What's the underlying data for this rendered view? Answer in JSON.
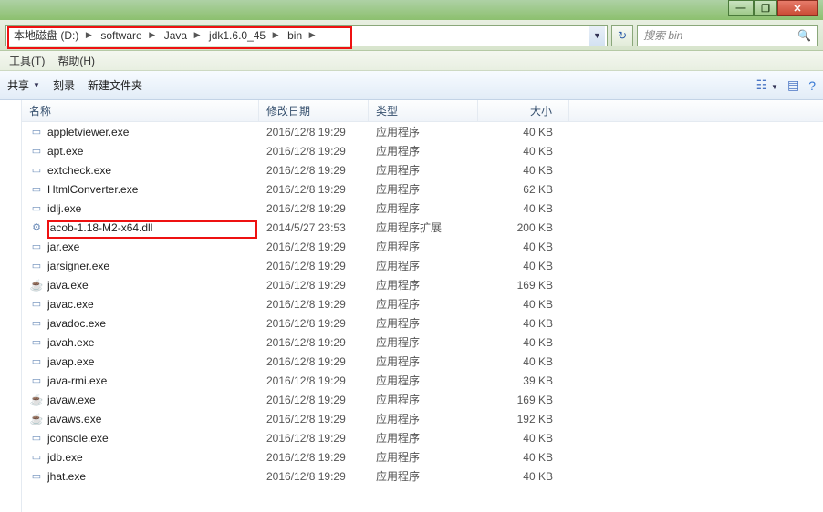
{
  "window": {
    "minimize": "—",
    "maximize": "❐",
    "close": "✕"
  },
  "breadcrumb": {
    "items": [
      "本地磁盘 (D:)",
      "software",
      "Java",
      "jdk1.6.0_45",
      "bin"
    ]
  },
  "search": {
    "placeholder": "搜索 bin"
  },
  "menu": {
    "tools": "工具(T)",
    "help": "帮助(H)"
  },
  "toolbar": {
    "share": "共享",
    "burn": "刻录",
    "newfolder": "新建文件夹"
  },
  "columns": {
    "name": "名称",
    "date": "修改日期",
    "type": "类型",
    "size": "大小"
  },
  "types": {
    "app": "应用程序",
    "ext": "应用程序扩展"
  },
  "files": [
    {
      "name": "appletviewer.exe",
      "date": "2016/12/8 19:29",
      "typeKey": "app",
      "size": "40 KB",
      "icon": "exe"
    },
    {
      "name": "apt.exe",
      "date": "2016/12/8 19:29",
      "typeKey": "app",
      "size": "40 KB",
      "icon": "exe"
    },
    {
      "name": "extcheck.exe",
      "date": "2016/12/8 19:29",
      "typeKey": "app",
      "size": "40 KB",
      "icon": "exe"
    },
    {
      "name": "HtmlConverter.exe",
      "date": "2016/12/8 19:29",
      "typeKey": "app",
      "size": "62 KB",
      "icon": "exe"
    },
    {
      "name": "idlj.exe",
      "date": "2016/12/8 19:29",
      "typeKey": "app",
      "size": "40 KB",
      "icon": "exe"
    },
    {
      "name": "jacob-1.18-M2-x64.dll",
      "date": "2014/5/27 23:53",
      "typeKey": "ext",
      "size": "200 KB",
      "icon": "dll"
    },
    {
      "name": "jar.exe",
      "date": "2016/12/8 19:29",
      "typeKey": "app",
      "size": "40 KB",
      "icon": "exe"
    },
    {
      "name": "jarsigner.exe",
      "date": "2016/12/8 19:29",
      "typeKey": "app",
      "size": "40 KB",
      "icon": "exe"
    },
    {
      "name": "java.exe",
      "date": "2016/12/8 19:29",
      "typeKey": "app",
      "size": "169 KB",
      "icon": "java"
    },
    {
      "name": "javac.exe",
      "date": "2016/12/8 19:29",
      "typeKey": "app",
      "size": "40 KB",
      "icon": "exe"
    },
    {
      "name": "javadoc.exe",
      "date": "2016/12/8 19:29",
      "typeKey": "app",
      "size": "40 KB",
      "icon": "exe"
    },
    {
      "name": "javah.exe",
      "date": "2016/12/8 19:29",
      "typeKey": "app",
      "size": "40 KB",
      "icon": "exe"
    },
    {
      "name": "javap.exe",
      "date": "2016/12/8 19:29",
      "typeKey": "app",
      "size": "40 KB",
      "icon": "exe"
    },
    {
      "name": "java-rmi.exe",
      "date": "2016/12/8 19:29",
      "typeKey": "app",
      "size": "39 KB",
      "icon": "exe"
    },
    {
      "name": "javaw.exe",
      "date": "2016/12/8 19:29",
      "typeKey": "app",
      "size": "169 KB",
      "icon": "java"
    },
    {
      "name": "javaws.exe",
      "date": "2016/12/8 19:29",
      "typeKey": "app",
      "size": "192 KB",
      "icon": "java"
    },
    {
      "name": "jconsole.exe",
      "date": "2016/12/8 19:29",
      "typeKey": "app",
      "size": "40 KB",
      "icon": "exe"
    },
    {
      "name": "jdb.exe",
      "date": "2016/12/8 19:29",
      "typeKey": "app",
      "size": "40 KB",
      "icon": "exe"
    },
    {
      "name": "jhat.exe",
      "date": "2016/12/8 19:29",
      "typeKey": "app",
      "size": "40 KB",
      "icon": "exe"
    }
  ],
  "highlights": {
    "address": true,
    "file_index": 5
  }
}
